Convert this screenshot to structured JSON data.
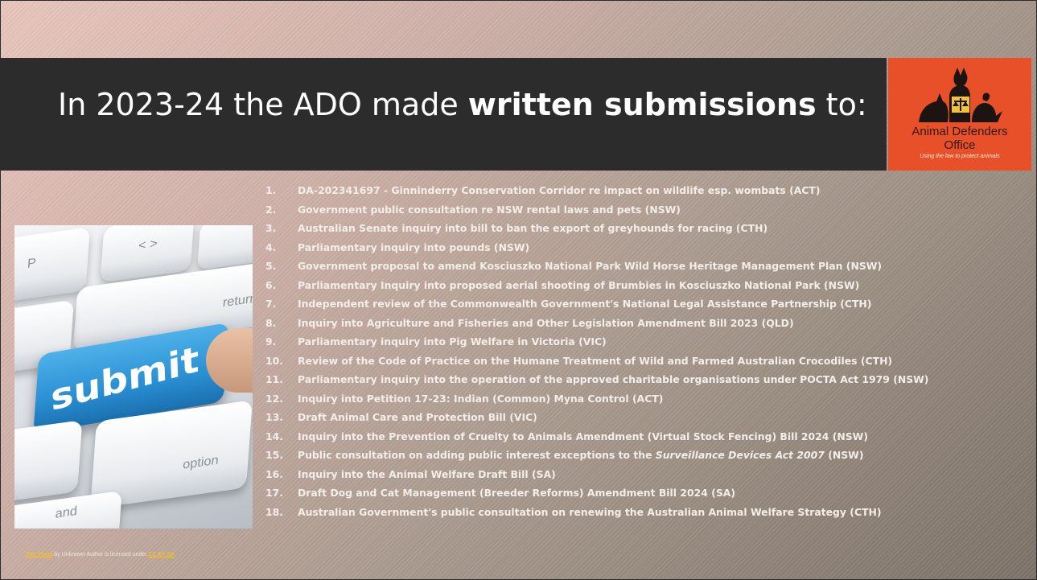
{
  "slide": {
    "title_plain": "In 2023-24 the ADO made ",
    "title_bold": "written submissions",
    "title_end": " to:"
  },
  "logo": {
    "name_line1": "Animal Defenders",
    "name_line2": "Office",
    "tagline": "Using the law to protect animals",
    "color": "#e8502a"
  },
  "photo": {
    "key_label": "submit",
    "other_keys": [
      "P",
      "return",
      "option",
      "and"
    ],
    "attribution": {
      "link1": "This Photo",
      "middle": " by Unknown Author is licensed under ",
      "link2": "CC BY-SA"
    }
  },
  "submissions": [
    {
      "num": "1.",
      "text": "DA-202341697 - Ginninderry Conservation Corridor re impact on wildlife esp. wombats (ACT)"
    },
    {
      "num": "2.",
      "text": "Government public consultation re NSW rental laws and pets (NSW)"
    },
    {
      "num": "3.",
      "text": "Australian Senate inquiry into bill to ban the export of greyhounds for racing (CTH)"
    },
    {
      "num": "4.",
      "text": "Parliamentary inquiry into pounds (NSW)"
    },
    {
      "num": "5.",
      "text": "Government proposal to amend Kosciuszko National Park Wild Horse Heritage Management Plan (NSW)"
    },
    {
      "num": "6.",
      "text": "Parliamentary Inquiry into proposed aerial shooting of Brumbies in Kosciuszko National Park (NSW)"
    },
    {
      "num": "7.",
      "text": "Independent review of the Commonwealth Government's National Legal Assistance Partnership (CTH)"
    },
    {
      "num": "8.",
      "text": "Inquiry into Agriculture and Fisheries and Other Legislation Amendment Bill 2023 (QLD)"
    },
    {
      "num": "9.",
      "text": "Parliamentary inquiry into Pig Welfare in Victoria (VIC)"
    },
    {
      "num": "10.",
      "text": "Review of the Code of Practice on the Humane Treatment of Wild and Farmed Australian Crocodiles (CTH)"
    },
    {
      "num": "11.",
      "text": "Parliamentary inquiry into the operation of the approved charitable organisations under POCTA Act 1979 (NSW)"
    },
    {
      "num": "12.",
      "text": "Inquiry into Petition 17-23: Indian (Common) Myna Control (ACT)"
    },
    {
      "num": "13.",
      "text": "Draft Animal Care and Protection Bill (VIC)"
    },
    {
      "num": "14.",
      "text": "Inquiry into the Prevention of Cruelty to Animals Amendment (Virtual Stock Fencing) Bill 2024 (NSW)"
    },
    {
      "num": "15.",
      "text_before": "Public consultation on adding public interest exceptions to the ",
      "text_italic": "Surveillance Devices Act 2007",
      "text_after": " (NSW)"
    },
    {
      "num": "16.",
      "text": "Inquiry into the Animal Welfare Draft Bill (SA)"
    },
    {
      "num": "17.",
      "text": "Draft Dog and Cat Management (Breeder Reforms) Amendment Bill 2024 (SA)"
    },
    {
      "num": "18.",
      "text": "Australian Government's public consultation on renewing the Australian Animal Welfare Strategy (CTH)"
    }
  ]
}
